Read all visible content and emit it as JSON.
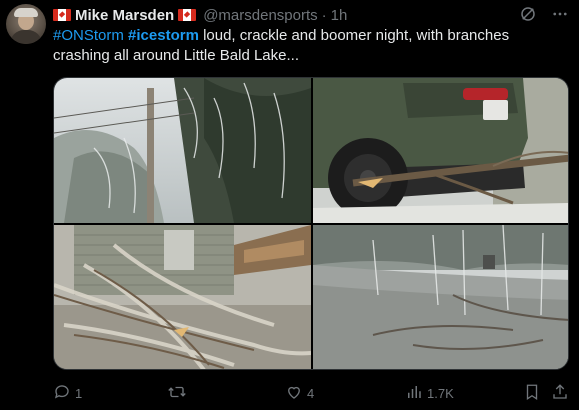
{
  "author": {
    "name": "Mike Marsden",
    "handle": "@marsdensports",
    "separator": "·",
    "time": "1h"
  },
  "tweet": {
    "hashtag1": "#ONStorm",
    "hashtag2": "#icestorm",
    "body": " loud, crackle and boomer night, with branches crashing all around Little Bald Lake..."
  },
  "media": {
    "photos": [
      {
        "name": "ice-covered-trees-hydro-pole-photo"
      },
      {
        "name": "suv-fallen-branch-photo"
      },
      {
        "name": "house-fallen-branches-photo"
      },
      {
        "name": "icy-driveway-fallen-trees-photo"
      }
    ]
  },
  "actions": {
    "replies": "1",
    "retweets": "",
    "likes": "4",
    "views": "1.7K"
  },
  "icons": {
    "reply": "reply-icon",
    "retweet": "retweet-icon",
    "like": "heart-icon",
    "views": "views-icon",
    "bookmark": "bookmark-icon",
    "share": "share-icon",
    "grok": "grok-icon",
    "more": "more-icon"
  },
  "colors": {
    "background": "#000000",
    "text": "#e7e9ea",
    "muted": "#71767b",
    "link": "#1d9bf0"
  }
}
